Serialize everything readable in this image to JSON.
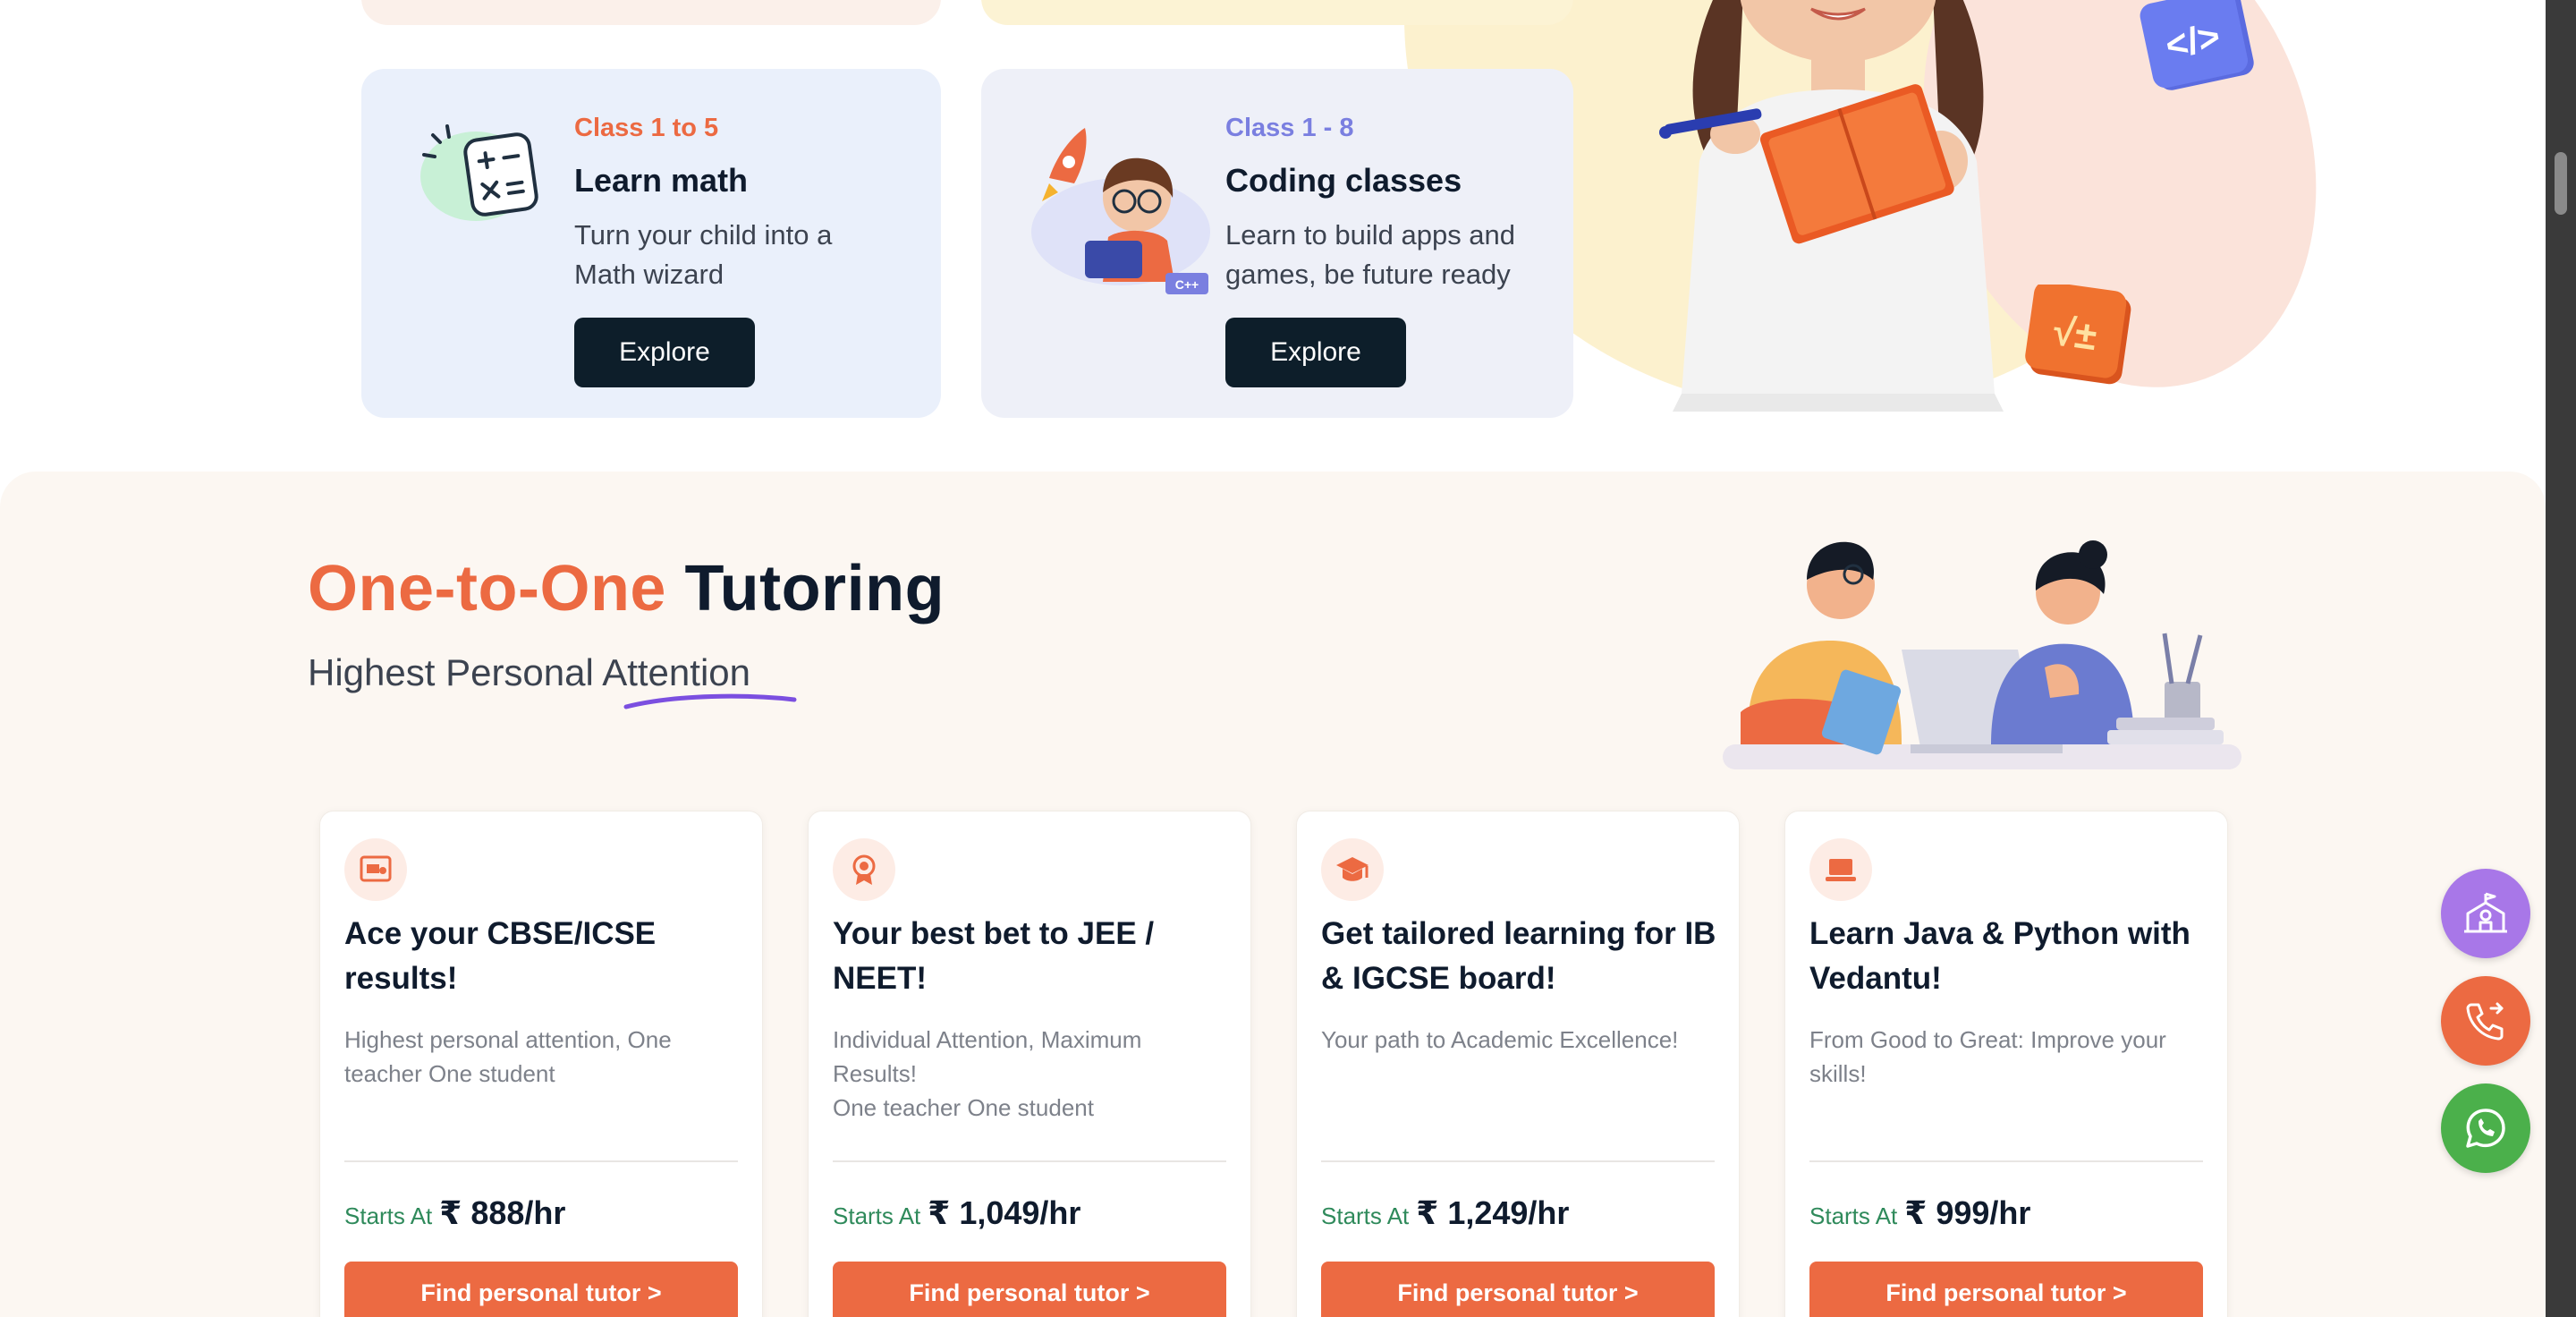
{
  "class_cards": [
    {
      "class_range": "Class 1 to 5",
      "class_color": "#ec6a42",
      "title": "Learn math",
      "description_lines": [
        "Turn your child into a",
        "Math wizard"
      ],
      "button_label": "Explore",
      "icon": "calculator-icon"
    },
    {
      "class_range": "Class 1 - 8",
      "class_color": "#7a7fe0",
      "title": "Coding classes",
      "description_lines": [
        "Learn to build apps and",
        "games, be future ready"
      ],
      "button_label": "Explore",
      "icon": "coding-kid-illustration"
    }
  ],
  "hero": {
    "code_badge": "</>",
    "math_badge": "√±"
  },
  "tutoring": {
    "title_accent": "One-to-One",
    "title_rest": "Tutoring",
    "subtitle_prefix": "Highest Personal",
    "subtitle_highlight": "Attention",
    "accent_color": "#ec6a42",
    "underline_color": "#7b4fe0"
  },
  "plans": [
    {
      "icon": "certificate-icon",
      "title": "Ace your CBSE/ICSE results!",
      "description_lines": [
        "Highest personal attention, One",
        "teacher One student"
      ],
      "starts_label": "Starts At",
      "price": "₹ 888/hr",
      "button_label": "Find personal tutor >"
    },
    {
      "icon": "medal-icon",
      "title": "Your best bet to JEE / NEET!",
      "description_lines": [
        "Individual Attention, Maximum",
        "Results!",
        "One teacher One student"
      ],
      "starts_label": "Starts At",
      "price": "₹ 1,049/hr",
      "button_label": "Find personal tutor >"
    },
    {
      "icon": "graduation-cap-icon",
      "title": "Get tailored learning for IB & IGCSE board!",
      "description_lines": [
        "Your path to Academic Excellence!"
      ],
      "starts_label": "Starts At",
      "price": "₹ 1,249/hr",
      "button_label": "Find personal tutor >"
    },
    {
      "icon": "laptop-icon",
      "title": "Learn Java & Python with Vedantu!",
      "description_lines": [
        "From Good to Great: Improve your",
        "skills!"
      ],
      "starts_label": "Starts At",
      "price": "₹ 999/hr",
      "button_label": "Find personal tutor >"
    }
  ],
  "floating_actions": [
    {
      "icon": "school-icon",
      "color": "#a877e8"
    },
    {
      "icon": "phone-callback-icon",
      "color": "#ec6a42"
    },
    {
      "icon": "whatsapp-icon",
      "color": "#4bb04b"
    }
  ]
}
